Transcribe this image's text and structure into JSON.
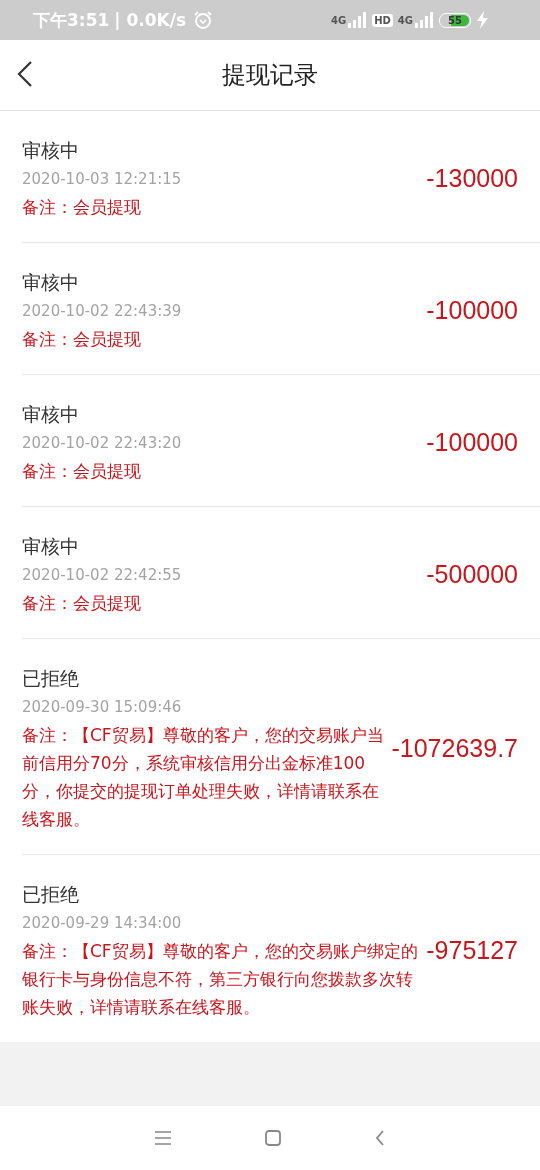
{
  "status_bar": {
    "time": "下午3:51",
    "speed": "| 0.0K/s",
    "network_1": "4G",
    "hd": "HD",
    "network_2": "4G",
    "battery": "55"
  },
  "header": {
    "title": "提现记录"
  },
  "records": [
    {
      "status": "审核中",
      "time": "2020-10-03 12:21:15",
      "note": "备注：会员提现",
      "amount": "-130000"
    },
    {
      "status": "审核中",
      "time": "2020-10-02 22:43:39",
      "note": "备注：会员提现",
      "amount": "-100000"
    },
    {
      "status": "审核中",
      "time": "2020-10-02 22:43:20",
      "note": "备注：会员提现",
      "amount": "-100000"
    },
    {
      "status": "审核中",
      "time": "2020-10-02 22:42:55",
      "note": "备注：会员提现",
      "amount": "-500000"
    },
    {
      "status": "已拒绝",
      "time": "2020-09-30 15:09:46",
      "note": "备注：【CF贸易】尊敬的客户，您的交易账户当前信用分70分，系统审核信用分出金标准100分，你提交的提现订单处理失败，详情请联系在线客服。",
      "amount": "-1072639.7"
    },
    {
      "status": "已拒绝",
      "time": "2020-09-29 14:34:00",
      "note": "备注：【CF贸易】尊敬的客户，您的交易账户绑定的银行卡与身份信息不符，第三方银行向您拨款多次转账失败，详情请联系在线客服。",
      "amount": "-975127"
    }
  ]
}
